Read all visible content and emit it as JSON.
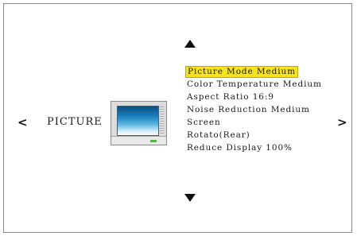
{
  "nav": {
    "left_arrow": "<",
    "right_arrow": ">",
    "section_label": "PICTURE"
  },
  "icons": {
    "up": "up-triangle",
    "down": "down-triangle",
    "tv": "tv-icon"
  },
  "colors": {
    "highlight": "#f7e31b",
    "screen_top": "#0a4f82",
    "screen_mid": "#1c80be"
  },
  "menu": {
    "items": [
      {
        "label": "Picture Mode  Medium",
        "selected": true
      },
      {
        "label": "Color Temperature Medium",
        "selected": false
      },
      {
        "label": "Aspect Ratio 16:9",
        "selected": false
      },
      {
        "label": "Noise Reduction Medium",
        "selected": false
      },
      {
        "label": "Screen",
        "selected": false
      },
      {
        "label": "Rotato(Rear)",
        "selected": false
      },
      {
        "label": "Reduce Display 100%",
        "selected": false
      }
    ]
  }
}
